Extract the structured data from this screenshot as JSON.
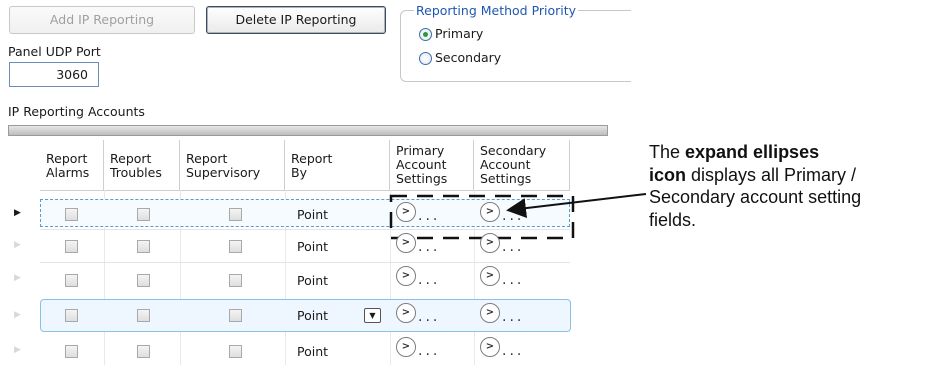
{
  "toolbar": {
    "add_label": "Add IP Reporting",
    "delete_label": "Delete IP Reporting"
  },
  "priority": {
    "legend": "Reporting Method Priority",
    "options": [
      {
        "label": "Primary",
        "selected": true
      },
      {
        "label": "Secondary",
        "selected": false
      }
    ]
  },
  "udp": {
    "label": "Panel UDP Port",
    "value": "3060"
  },
  "accounts": {
    "title": "IP Reporting Accounts",
    "columns": {
      "report_alarms": [
        "Report",
        "Alarms"
      ],
      "report_troubles": [
        "Report",
        "Troubles"
      ],
      "report_supervisory": [
        "Report",
        "Supervisory"
      ],
      "report_by": [
        "Report",
        "By"
      ],
      "primary_settings": [
        "Primary",
        "Account",
        "Settings"
      ],
      "secondary_settings": [
        "Secondary",
        "Account",
        "Settings"
      ]
    },
    "rows": [
      {
        "report_by": "Point",
        "ellipsis": "...",
        "current": true
      },
      {
        "report_by": "Point",
        "ellipsis": "...",
        "current": false
      },
      {
        "report_by": "Point",
        "ellipsis": "...",
        "current": false
      },
      {
        "report_by": "Point",
        "ellipsis": "...",
        "current": false
      },
      {
        "report_by": "Point",
        "ellipsis": "...",
        "current": false
      }
    ]
  },
  "annotation": {
    "line1_pre": "The ",
    "line1_bold": "expand ellipses",
    "line2_bold": "icon",
    "line2_post": " displays all Primary /",
    "line3": "Secondary account setting",
    "line4": "fields."
  },
  "colors": {
    "legend_blue": "#1f57b0",
    "radio_selected_green": "#2d9a3a",
    "selected_row_border": "#8ac0e6",
    "highlight_row_fill": "#eef7ff"
  },
  "icons": {
    "expand": "expand-ellipses-icon",
    "dropdown": "chevron-down-icon",
    "row_marker": "row-selector-triangle-icon"
  }
}
